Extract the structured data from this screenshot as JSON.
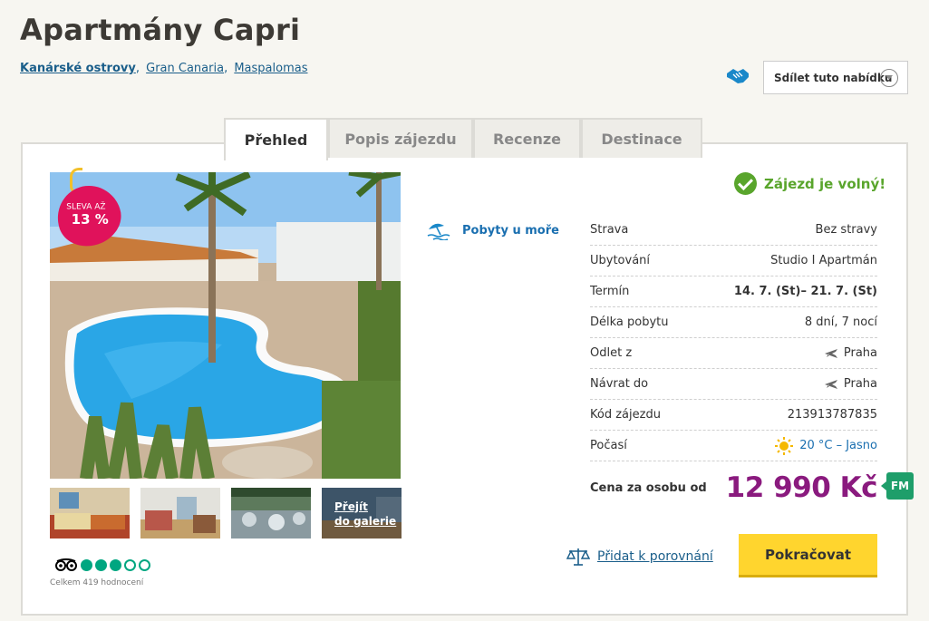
{
  "hotel": {
    "title": "Apartmány Capri"
  },
  "breadcrumbs": {
    "items": [
      "Kanárské ostrovy",
      "Gran Canaria",
      "Maspalomas"
    ]
  },
  "share": {
    "label": "Sdílet tuto nabídku"
  },
  "tabs": [
    {
      "label": "Přehled",
      "active": true
    },
    {
      "label": "Popis zájezdu",
      "active": false
    },
    {
      "label": "Recenze",
      "active": false
    },
    {
      "label": "Destinace",
      "active": false
    }
  ],
  "discount": {
    "line1": "SLEVA AŽ",
    "line2": "13 %"
  },
  "gallery": {
    "link_line1": "Přejít",
    "link_line2": "do galerie"
  },
  "rating": {
    "filled": 3,
    "total": 5,
    "count_text": "Celkem 419 hodnocení"
  },
  "category": {
    "label": "Pobyty u moře"
  },
  "availability": {
    "label": "Zájezd je volný!"
  },
  "details": [
    {
      "label": "Strava",
      "value": "Bez stravy"
    },
    {
      "label": "Ubytování",
      "value": "Studio I Apartmán"
    },
    {
      "label": "Termín",
      "value": "14. 7. (St)– 21. 7. (St)"
    },
    {
      "label": "Délka pobytu",
      "value": "8 dní, 7 nocí"
    },
    {
      "label": "Odlet z",
      "value": "Praha"
    },
    {
      "label": "Návrat do",
      "value": "Praha"
    },
    {
      "label": "Kód zájezdu",
      "value": "213913787835"
    },
    {
      "label": "Počasí",
      "value": "20 °C – Jasno"
    }
  ],
  "price": {
    "label": "Cena za osobu od",
    "value": "12 990 Kč",
    "badge": "FM"
  },
  "actions": {
    "compare": "Přidat k porovnání",
    "continue": "Pokračovat"
  },
  "colors": {
    "accent_purple": "#8a1a7e",
    "cta_yellow": "#ffd52e",
    "link_blue": "#1a5e8a",
    "success_green": "#59a52c"
  }
}
